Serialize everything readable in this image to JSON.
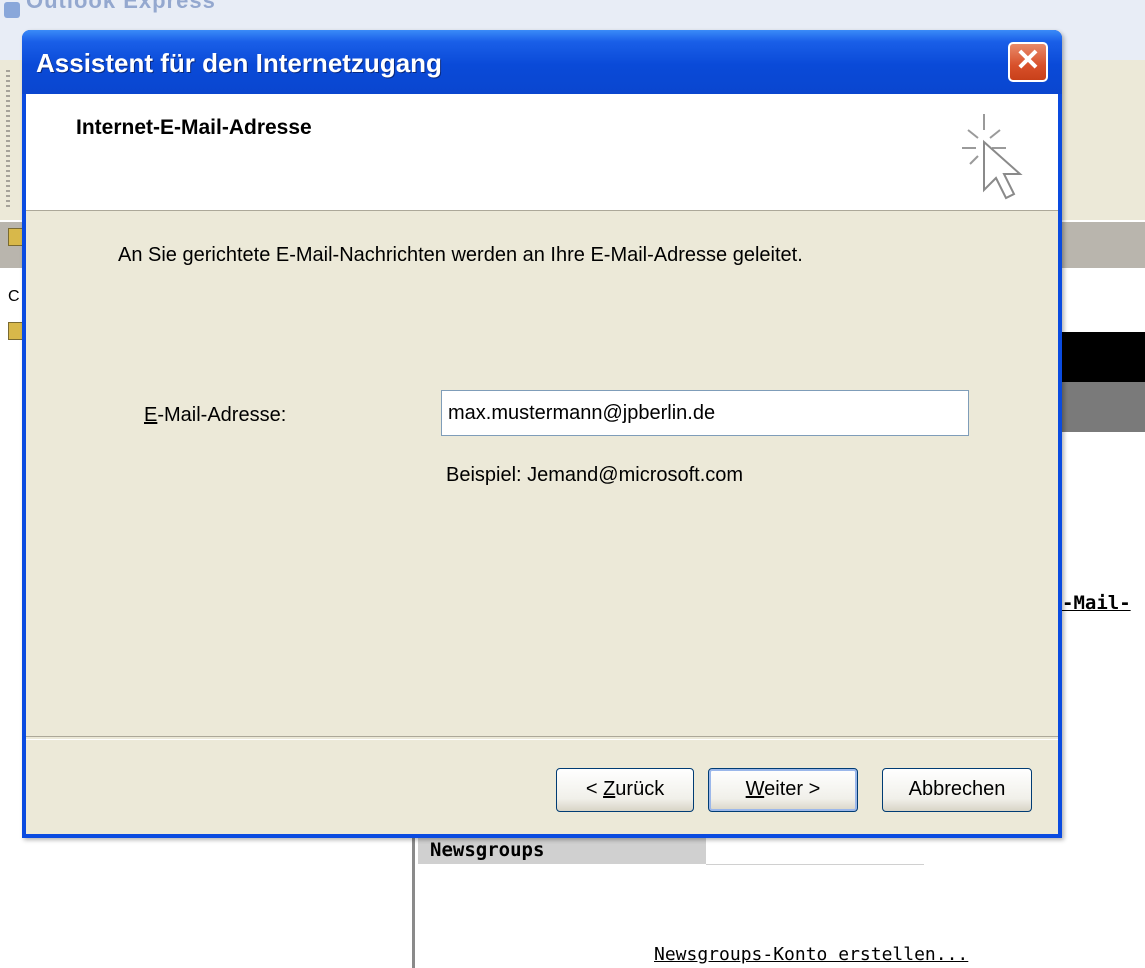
{
  "background_window": {
    "title": "Outlook Express",
    "side_link_text": "-Mail-",
    "newsgroups_header": "Newsgroups",
    "newsgroups_link": "Newsgroups-Konto erstellen...",
    "left_pane_letter": "C"
  },
  "dialog": {
    "title": "Assistent für den Internetzugang",
    "close_icon": "close-icon",
    "header_title": "Internet-E-Mail-Adresse",
    "header_icon": "cursor-sparkle-icon",
    "intro_text": "An Sie gerichtete E-Mail-Nachrichten werden an Ihre E-Mail-Adresse geleitet.",
    "email_label_accel": "E",
    "email_label_rest": "-Mail-Adresse:",
    "email_value": "max.mustermann@jpberlin.de",
    "example_text": "Beispiel: Jemand@microsoft.com",
    "buttons": {
      "back_prefix": "< ",
      "back_accel": "Z",
      "back_rest": "urück",
      "next_accel": "W",
      "next_rest": "eiter >",
      "cancel": "Abbrechen"
    }
  }
}
